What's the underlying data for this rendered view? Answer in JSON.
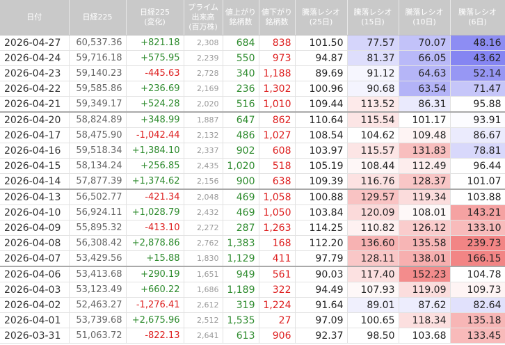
{
  "headers": [
    "日付",
    "日経225",
    "日経225\n(変化)",
    "プライム\n出来高\n(百万株)",
    "値上がり\n銘柄数",
    "値下がり\n銘柄数",
    "騰落レシオ\n(25日)",
    "騰落レシオ\n(15日)",
    "騰落レシオ\n(10日)",
    "騰落レシオ\n(6日)"
  ],
  "rows": [
    {
      "date": "2026-04-27",
      "nikkei": "60,537.36",
      "change": "+821.18",
      "volume": "2,308",
      "adv": "684",
      "dec": "838",
      "r25": "101.50",
      "r15": "77.57",
      "r10": "70.07",
      "r6": "48.16",
      "week_start": false
    },
    {
      "date": "2026-04-24",
      "nikkei": "59,716.18",
      "change": "+575.95",
      "volume": "2,239",
      "adv": "550",
      "dec": "973",
      "r25": "94.87",
      "r15": "81.37",
      "r10": "66.05",
      "r6": "43.62",
      "week_start": false
    },
    {
      "date": "2026-04-23",
      "nikkei": "59,140.23",
      "change": "-445.63",
      "volume": "2,728",
      "adv": "340",
      "dec": "1,188",
      "r25": "89.69",
      "r15": "91.12",
      "r10": "64.63",
      "r6": "52.14",
      "week_start": false
    },
    {
      "date": "2026-04-22",
      "nikkei": "59,585.86",
      "change": "+236.69",
      "volume": "2,169",
      "adv": "236",
      "dec": "1,302",
      "r25": "100.96",
      "r15": "90.68",
      "r10": "63.54",
      "r6": "71.47",
      "week_start": false
    },
    {
      "date": "2026-04-21",
      "nikkei": "59,349.17",
      "change": "+524.28",
      "volume": "2,020",
      "adv": "516",
      "dec": "1,010",
      "r25": "109.44",
      "r15": "113.52",
      "r10": "86.31",
      "r6": "95.88",
      "week_start": false
    },
    {
      "date": "2026-04-20",
      "nikkei": "58,824.89",
      "change": "+348.99",
      "volume": "1,887",
      "adv": "647",
      "dec": "862",
      "r25": "110.64",
      "r15": "115.54",
      "r10": "101.17",
      "r6": "93.91",
      "week_start": true
    },
    {
      "date": "2026-04-17",
      "nikkei": "58,475.90",
      "change": "-1,042.44",
      "volume": "2,132",
      "adv": "486",
      "dec": "1,027",
      "r25": "108.54",
      "r15": "104.62",
      "r10": "109.48",
      "r6": "86.67",
      "week_start": false
    },
    {
      "date": "2026-04-16",
      "nikkei": "59,518.34",
      "change": "+1,384.10",
      "volume": "2,337",
      "adv": "902",
      "dec": "608",
      "r25": "103.97",
      "r15": "115.57",
      "r10": "131.83",
      "r6": "78.81",
      "week_start": false
    },
    {
      "date": "2026-04-15",
      "nikkei": "58,134.24",
      "change": "+256.85",
      "volume": "2,435",
      "adv": "1,020",
      "dec": "518",
      "r25": "105.19",
      "r15": "108.44",
      "r10": "112.49",
      "r6": "96.44",
      "week_start": false
    },
    {
      "date": "2026-04-14",
      "nikkei": "57,877.39",
      "change": "+1,374.62",
      "volume": "2,156",
      "adv": "900",
      "dec": "638",
      "r25": "109.39",
      "r15": "116.76",
      "r10": "128.37",
      "r6": "101.07",
      "week_start": false
    },
    {
      "date": "2026-04-13",
      "nikkei": "56,502.77",
      "change": "-421.34",
      "volume": "2,048",
      "adv": "469",
      "dec": "1,058",
      "r25": "100.88",
      "r15": "129.57",
      "r10": "119.34",
      "r6": "103.88",
      "week_start": true
    },
    {
      "date": "2026-04-10",
      "nikkei": "56,924.11",
      "change": "+1,028.79",
      "volume": "2,432",
      "adv": "469",
      "dec": "1,050",
      "r25": "103.84",
      "r15": "120.09",
      "r10": "108.01",
      "r6": "143.21",
      "week_start": false
    },
    {
      "date": "2026-04-09",
      "nikkei": "55,895.32",
      "change": "-413.10",
      "volume": "2,272",
      "adv": "287",
      "dec": "1,263",
      "r25": "114.25",
      "r15": "110.82",
      "r10": "126.12",
      "r6": "133.10",
      "week_start": false
    },
    {
      "date": "2026-04-08",
      "nikkei": "56,308.42",
      "change": "+2,878.86",
      "volume": "2,762",
      "adv": "1,383",
      "dec": "168",
      "r25": "112.20",
      "r15": "136.60",
      "r10": "135.58",
      "r6": "239.73",
      "week_start": false
    },
    {
      "date": "2026-04-07",
      "nikkei": "53,429.56",
      "change": "+15.88",
      "volume": "1,830",
      "adv": "1,129",
      "dec": "411",
      "r25": "97.79",
      "r15": "128.11",
      "r10": "138.01",
      "r6": "166.15",
      "week_start": false
    },
    {
      "date": "2026-04-06",
      "nikkei": "53,413.68",
      "change": "+290.19",
      "volume": "1,651",
      "adv": "949",
      "dec": "561",
      "r25": "90.03",
      "r15": "117.40",
      "r10": "152.23",
      "r6": "104.78",
      "week_start": true
    },
    {
      "date": "2026-04-03",
      "nikkei": "53,123.49",
      "change": "+660.22",
      "volume": "1,686",
      "adv": "1,189",
      "dec": "322",
      "r25": "94.49",
      "r15": "107.93",
      "r10": "119.09",
      "r6": "109.73",
      "week_start": false
    },
    {
      "date": "2026-04-02",
      "nikkei": "52,463.27",
      "change": "-1,276.41",
      "volume": "2,612",
      "adv": "319",
      "dec": "1,224",
      "r25": "91.64",
      "r15": "89.01",
      "r10": "87.62",
      "r6": "82.64",
      "week_start": false
    },
    {
      "date": "2026-04-01",
      "nikkei": "53,739.68",
      "change": "+2,675.96",
      "volume": "2,512",
      "adv": "1,535",
      "dec": "27",
      "r25": "97.09",
      "r15": "100.65",
      "r10": "118.34",
      "r6": "135.18",
      "week_start": false
    },
    {
      "date": "2026-03-31",
      "nikkei": "51,063.72",
      "change": "-822.13",
      "volume": "2,641",
      "adv": "613",
      "dec": "906",
      "r25": "92.37",
      "r15": "98.50",
      "r10": "103.68",
      "r6": "133.45",
      "week_start": false
    }
  ],
  "colors": {
    "header_bg": "#c9c9c9",
    "up": "#2e8b2e",
    "down": "#dd1d1d",
    "low_ratio": "#7070f0",
    "high_ratio": "#f07070"
  }
}
